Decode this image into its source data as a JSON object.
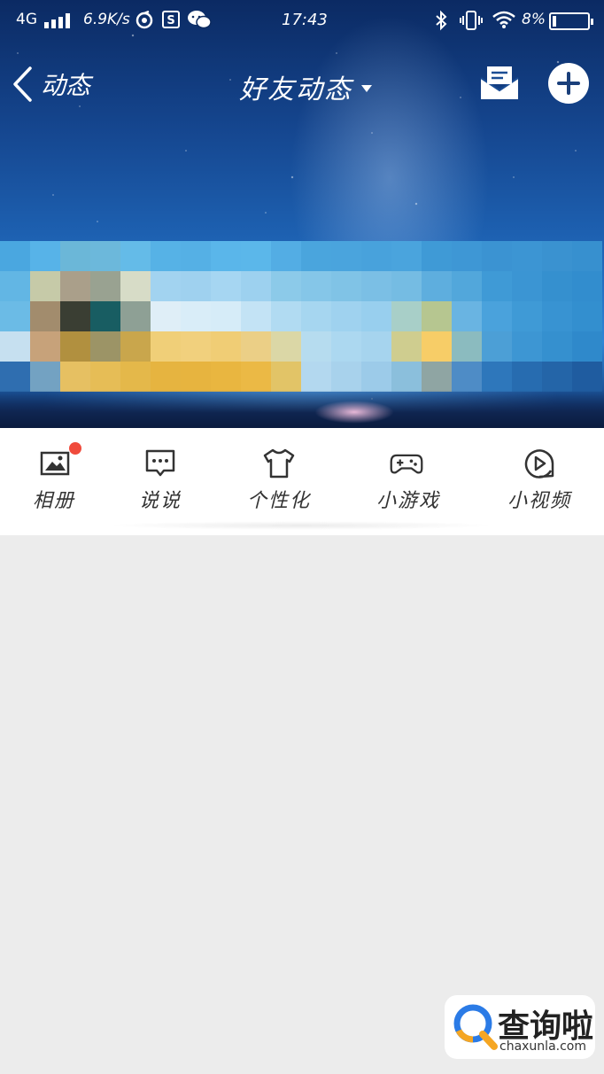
{
  "status_bar": {
    "network": "4G",
    "speed": "6.9K/s",
    "time": "17:43",
    "battery": "8%"
  },
  "nav": {
    "back_label": "动态",
    "title": "好友动态"
  },
  "quick_menu": {
    "items": [
      {
        "label": "相册",
        "icon": "album-icon",
        "badge": true
      },
      {
        "label": "说说",
        "icon": "chat-bubble-icon",
        "badge": false
      },
      {
        "label": "个性化",
        "icon": "tshirt-icon",
        "badge": false
      },
      {
        "label": "小游戏",
        "icon": "gamepad-icon",
        "badge": false
      },
      {
        "label": "小视频",
        "icon": "video-play-icon",
        "badge": false
      }
    ]
  },
  "watermark": {
    "name": "查询啦",
    "url": "chaxunla.com"
  },
  "colors": {
    "badge": "#f04b3c",
    "page_bg": "#ececec",
    "text": "#333333"
  }
}
